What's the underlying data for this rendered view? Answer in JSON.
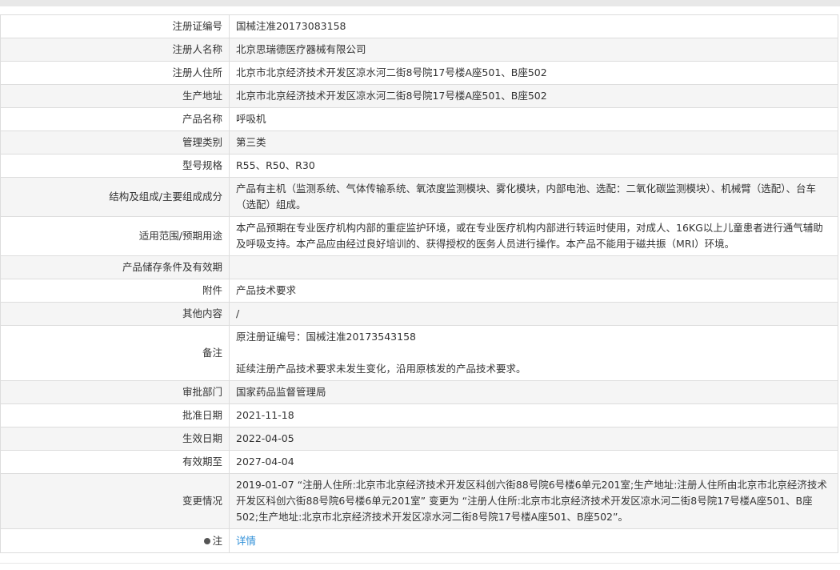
{
  "rows": [
    {
      "label": "注册证编号",
      "value": "国械注准20173083158",
      "h": 29
    },
    {
      "label": "注册人名称",
      "value": "北京思瑞德医疗器械有限公司",
      "h": 29
    },
    {
      "label": "注册人住所",
      "value": "北京市北京经济技术开发区凉水河二街8号院17号楼A座501、B座502",
      "h": 29
    },
    {
      "label": "生产地址",
      "value": "北京市北京经济技术开发区凉水河二街8号院17号楼A座501、B座502",
      "h": 29
    },
    {
      "label": "产品名称",
      "value": "呼吸机",
      "h": 29
    },
    {
      "label": "管理类别",
      "value": "第三类",
      "h": 29
    },
    {
      "label": "型号规格",
      "value": "R55、R50、R30",
      "h": 29
    },
    {
      "label": "结构及组成/主要组成成分",
      "value": "产品有主机（监测系统、气体传输系统、氧浓度监测模块、雾化模块，内部电池、选配：二氧化碳监测模块）、机械臂（选配）、台车（选配）组成。",
      "h": 49
    },
    {
      "label": "适用范围/预期用途",
      "value": "本产品预期在专业医疗机构内部的重症监护环境，或在专业医疗机构内部进行转运时使用，对成人、16KG以上儿童患者进行通气辅助及呼吸支持。本产品应由经过良好培训的、获得授权的医务人员进行操作。本产品不能用于磁共振（MRI）环境。",
      "h": 49
    },
    {
      "label": "产品储存条件及有效期",
      "value": "",
      "h": 29
    },
    {
      "label": "附件",
      "value": "产品技术要求",
      "h": 29
    },
    {
      "label": "其他内容",
      "value": "/",
      "h": 29
    },
    {
      "label": "备注",
      "value": "原注册证编号：国械注准20173543158\n\n延续注册产品技术要求未发生变化，沿用原核发的产品技术要求。",
      "h": 69
    },
    {
      "label": "审批部门",
      "value": "国家药品监督管理局",
      "h": 29
    },
    {
      "label": "批准日期",
      "value": "2021-11-18",
      "h": 29
    },
    {
      "label": "生效日期",
      "value": "2022-04-05",
      "h": 29
    },
    {
      "label": "有效期至",
      "value": "2027-04-04",
      "h": 29
    },
    {
      "label": "变更情况",
      "value": "2019-01-07 “注册人住所:北京市北京经济技术开发区科创六街88号院6号楼6单元201室;生产地址:注册人住所由北京市北京经济技术开发区科创六街88号院6号楼6单元201室” 变更为 “注册人住所:北京市北京经济技术开发区凉水河二街8号院17号楼A座501、B座502;生产地址:北京市北京经济技术开发区凉水河二街8号院17号楼A座501、B座502”。",
      "h": 69
    }
  ],
  "note": {
    "label": "注",
    "link": "详情"
  }
}
